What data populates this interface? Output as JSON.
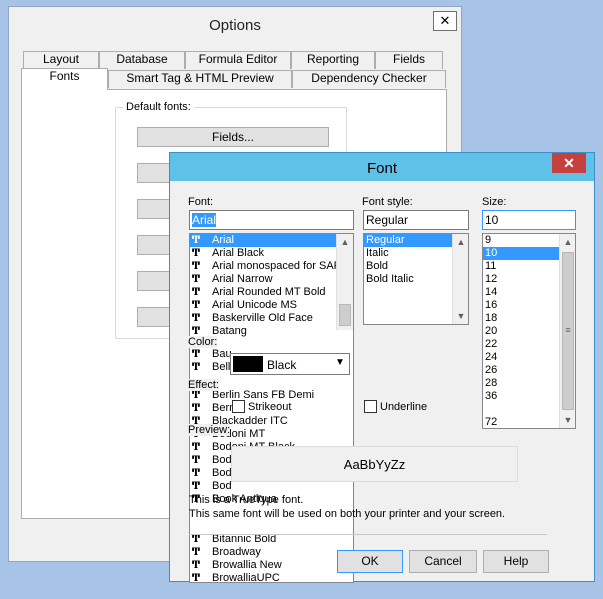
{
  "options": {
    "title": "Options",
    "close_glyph": "✕",
    "tabs_row1": [
      "Layout",
      "Database",
      "Formula Editor",
      "Reporting",
      "Fields"
    ],
    "tabs_row2": [
      "Fonts",
      "Smart Tag & HTML Preview",
      "Dependency Checker"
    ],
    "group_label": "Default fonts:",
    "fields_button": "Fields..."
  },
  "font_dialog": {
    "title": "Font",
    "close_glyph": "✕",
    "font_label": "Font:",
    "font_value": "Arial",
    "font_list": [
      "Arial",
      "Arial Black",
      "Arial monospaced for SAP",
      "Arial Narrow",
      "Arial Rounded MT Bold",
      "Arial Unicode MS",
      "Baskerville Old Face",
      "Batang"
    ],
    "font_list_lower": [
      "Bitannic Bold",
      "Broadway",
      "Browallia New",
      "BrowalliaUPC"
    ],
    "font_overlap_items": [
      "Bau",
      "Bell",
      "Berlin Sans FB Demi",
      "Bern",
      "Blackadder ITC",
      "Bodoni MT",
      "Bodoni MT Black",
      "Bod",
      "Bod",
      "Bod",
      "Book Antiqua"
    ],
    "tt_glyph": "Ͳ",
    "style_label": "Font style:",
    "style_value": "Regular",
    "style_list": [
      "Regular",
      "Italic",
      "Bold",
      "Bold Italic"
    ],
    "size_label": "Size:",
    "size_value": "10",
    "size_list": [
      "9",
      "10",
      "11",
      "12",
      "14",
      "16",
      "18",
      "20",
      "22",
      "24",
      "26",
      "28",
      "36"
    ],
    "size_list_last": "72",
    "color_label": "Color:",
    "color_value": "Black",
    "color_hex": "#000000",
    "effect_label": "Effect:",
    "strikeout_label": "Strikeout",
    "underline_label": "Underline",
    "preview_label": "Preview:",
    "preview_text": "AaBbYyZz",
    "truetype_note": "This is a TrueType font.",
    "printer_note": "This same font will be used on both your printer and your screen.",
    "ok_label": "OK",
    "cancel_label": "Cancel",
    "help_label": "Help"
  }
}
